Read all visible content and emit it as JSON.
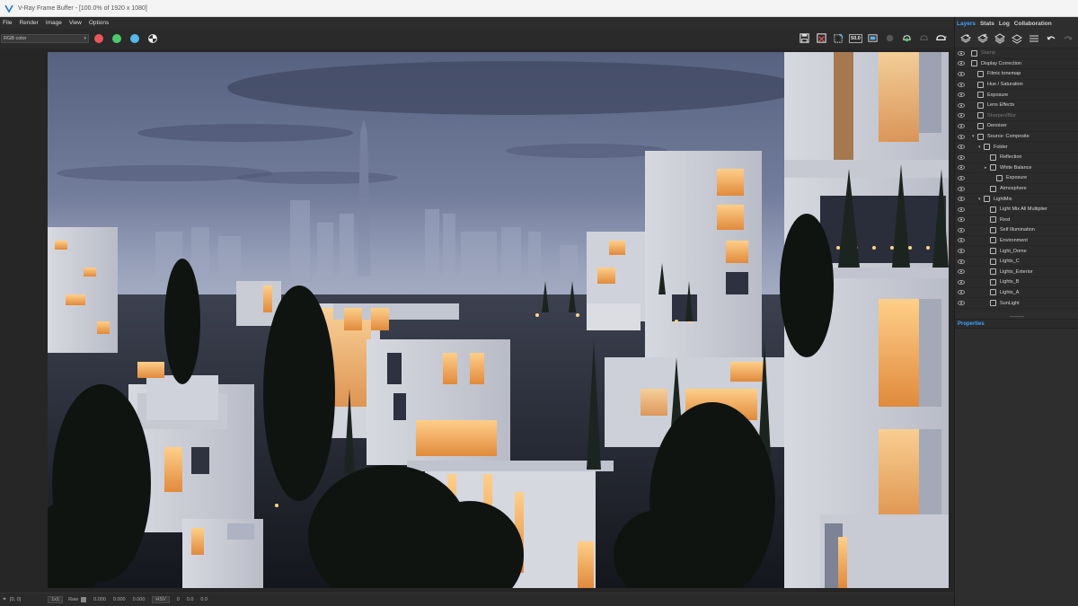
{
  "window": {
    "title": "V-Ray Frame Buffer - [100.0% of 1920 x 1080]"
  },
  "menu": [
    "File",
    "Render",
    "Image",
    "View",
    "Options"
  ],
  "toolbar": {
    "channel": "RGB color",
    "icons": [
      "save-icon",
      "save-all-icon",
      "clear-image-icon",
      "follow-mouse-icon",
      "track-mouse-icon",
      "region-icon",
      "stop-icon",
      "render-interactive-icon",
      "render-icon",
      "teapot-icon"
    ],
    "sample_label": "50.0"
  },
  "panel": {
    "tabs": [
      "Layers",
      "Stats",
      "Log",
      "Collaboration"
    ],
    "active_tab": "Layers",
    "layer_tool_icons": [
      "create-layer-icon",
      "delete-layer-icon",
      "load-preset-icon",
      "save-preset-icon",
      "list-icon",
      "undo-icon",
      "redo-icon"
    ],
    "layers": [
      {
        "name": "Stamp",
        "indent": 0,
        "disabled": true
      },
      {
        "name": "Display Correction",
        "indent": 0,
        "disabled": false
      },
      {
        "name": "Filmic tonemap",
        "indent": 1,
        "disabled": false
      },
      {
        "name": "Hue / Saturation",
        "indent": 1,
        "disabled": false
      },
      {
        "name": "Exposure",
        "indent": 1,
        "disabled": false
      },
      {
        "name": "Lens Effects",
        "indent": 1,
        "disabled": false
      },
      {
        "name": "Sharpen/Blur",
        "indent": 1,
        "disabled": true
      },
      {
        "name": "Denoiser",
        "indent": 1,
        "disabled": false
      },
      {
        "name": "Source: Composite",
        "indent": 1,
        "disabled": false,
        "expanded": true
      },
      {
        "name": "Folder",
        "indent": 2,
        "disabled": false,
        "expanded": true
      },
      {
        "name": "Reflection",
        "indent": 3,
        "disabled": false
      },
      {
        "name": "White Balance",
        "indent": 3,
        "disabled": false,
        "expanded": false
      },
      {
        "name": "Exposure",
        "indent": 4,
        "disabled": false
      },
      {
        "name": "Atmosphere",
        "indent": 3,
        "disabled": false
      },
      {
        "name": "LightMix",
        "indent": 2,
        "disabled": false,
        "expanded": true
      },
      {
        "name": "Light Mix All Multiplier",
        "indent": 3,
        "disabled": false
      },
      {
        "name": "Rest",
        "indent": 3,
        "disabled": false
      },
      {
        "name": "Self Illumination",
        "indent": 3,
        "disabled": false
      },
      {
        "name": "Environment",
        "indent": 3,
        "disabled": false
      },
      {
        "name": "Light_Dome",
        "indent": 3,
        "disabled": false
      },
      {
        "name": "Lights_C",
        "indent": 3,
        "disabled": false
      },
      {
        "name": "Lights_Exterior",
        "indent": 3,
        "disabled": false
      },
      {
        "name": "Lights_B",
        "indent": 3,
        "disabled": false
      },
      {
        "name": "Lights_A",
        "indent": 3,
        "disabled": false
      },
      {
        "name": "SunLight",
        "indent": 3,
        "disabled": false
      }
    ],
    "properties_label": "Properties"
  },
  "status": {
    "coords": "[0, 0]",
    "zoom": "1x1",
    "raw_label": "Raw",
    "values": [
      "0.000",
      "0.000",
      "0.000"
    ],
    "mode": "HSV",
    "hsv_values": [
      "0",
      "0.0",
      "0.0"
    ]
  },
  "colors": {
    "accent": "#3ea2ff",
    "red_channel": "#e8565c",
    "green_channel": "#4ec96e",
    "blue_channel": "#56b8ea"
  }
}
